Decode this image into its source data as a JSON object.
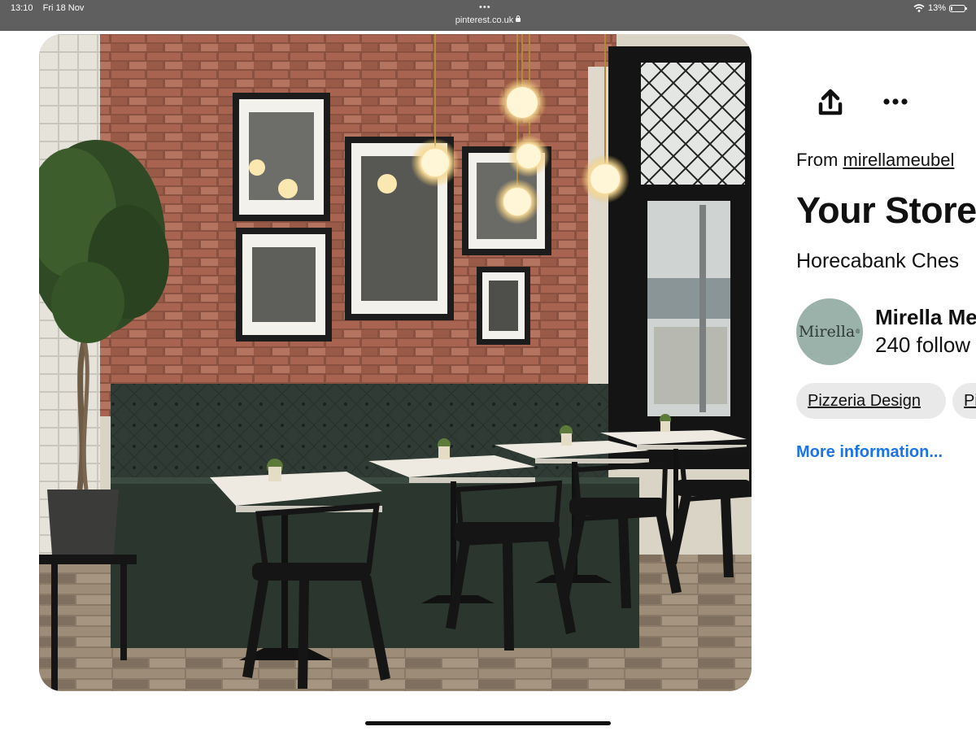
{
  "status_bar": {
    "time": "13:10",
    "date": "Fri 18 Nov",
    "url": "pinterest.co.uk",
    "battery": "13%",
    "battery_level": 0.13,
    "icons": [
      "wifi-icon",
      "battery-icon",
      "lock-icon",
      "multitask-dots-icon"
    ]
  },
  "pin": {
    "image_alt": "Café interior with red brick wall, framed black and white photos, green tufted bench, marble tables and black metal chairs",
    "source_prefix": "From ",
    "source_link": "mirellameubel",
    "title": "Your Store",
    "description": "Horecabank Ches",
    "creator": {
      "avatar_text": "Mirella",
      "avatar_mark": "®",
      "avatar_color": "#9bb2ab",
      "name": "Mirella Me",
      "followers": "240 follow"
    },
    "tags": [
      "Pizzeria Design",
      "Pi"
    ],
    "more_info": "More information..."
  },
  "actions": {
    "share_icon": "share-upload-icon",
    "more_icon": "more-options-icon"
  },
  "colors": {
    "status_bar_bg": "#5f5f5f",
    "link_blue": "#1a73e8",
    "tag_bg": "#e9e9e9"
  }
}
